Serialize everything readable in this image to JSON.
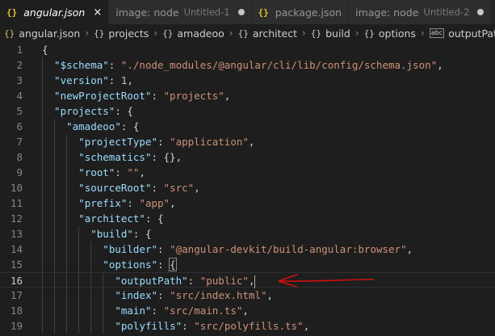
{
  "tabs": [
    {
      "icon": "json-file-icon",
      "glyph": "{}",
      "title": "angular.json",
      "active": true,
      "close": "×"
    },
    {
      "icon": "image-editor-icon",
      "glyph": "≡",
      "title": "image: node",
      "description": "Untitled-1",
      "dirty": true
    },
    {
      "icon": "json-file-icon",
      "glyph": "{}",
      "title": "package.json"
    },
    {
      "icon": "image-editor-icon",
      "glyph": "≡",
      "title": "image: node",
      "description": "Untitled-2",
      "dirty": true
    }
  ],
  "breadcrumb": [
    {
      "icon": "json-file-icon",
      "glyph": "{}",
      "label": "angular.json"
    },
    {
      "icon": "object-icon",
      "glyph": "{}",
      "label": "projects"
    },
    {
      "icon": "object-icon",
      "glyph": "{}",
      "label": "amadeoo"
    },
    {
      "icon": "object-icon",
      "glyph": "{}",
      "label": "architect"
    },
    {
      "icon": "object-icon",
      "glyph": "{}",
      "label": "build"
    },
    {
      "icon": "object-icon",
      "glyph": "{}",
      "label": "options"
    },
    {
      "icon": "string-icon",
      "glyph": "abc",
      "label": "outputPath"
    }
  ],
  "separator": "›",
  "lines": [
    {
      "n": "1",
      "indent": 0,
      "tokens": [
        {
          "t": "{",
          "c": "punct"
        }
      ]
    },
    {
      "n": "2",
      "indent": 1,
      "tokens": [
        {
          "t": "\"$schema\"",
          "c": "key"
        },
        {
          "t": ": ",
          "c": "punct"
        },
        {
          "t": "\"./node_modules/@angular/cli/lib/config/schema.json\"",
          "c": "str"
        },
        {
          "t": ",",
          "c": "punct"
        }
      ]
    },
    {
      "n": "3",
      "indent": 1,
      "tokens": [
        {
          "t": "\"version\"",
          "c": "key"
        },
        {
          "t": ": ",
          "c": "punct"
        },
        {
          "t": "1",
          "c": "num"
        },
        {
          "t": ",",
          "c": "punct"
        }
      ]
    },
    {
      "n": "4",
      "indent": 1,
      "tokens": [
        {
          "t": "\"newProjectRoot\"",
          "c": "key"
        },
        {
          "t": ": ",
          "c": "punct"
        },
        {
          "t": "\"projects\"",
          "c": "str"
        },
        {
          "t": ",",
          "c": "punct"
        }
      ]
    },
    {
      "n": "5",
      "indent": 1,
      "tokens": [
        {
          "t": "\"projects\"",
          "c": "key"
        },
        {
          "t": ": {",
          "c": "punct"
        }
      ]
    },
    {
      "n": "6",
      "indent": 2,
      "tokens": [
        {
          "t": "\"amadeoo\"",
          "c": "key"
        },
        {
          "t": ": {",
          "c": "punct"
        }
      ]
    },
    {
      "n": "7",
      "indent": 3,
      "tokens": [
        {
          "t": "\"projectType\"",
          "c": "key"
        },
        {
          "t": ": ",
          "c": "punct"
        },
        {
          "t": "\"application\"",
          "c": "str"
        },
        {
          "t": ",",
          "c": "punct"
        }
      ]
    },
    {
      "n": "8",
      "indent": 3,
      "tokens": [
        {
          "t": "\"schematics\"",
          "c": "key"
        },
        {
          "t": ": {},",
          "c": "punct"
        }
      ]
    },
    {
      "n": "9",
      "indent": 3,
      "tokens": [
        {
          "t": "\"root\"",
          "c": "key"
        },
        {
          "t": ": ",
          "c": "punct"
        },
        {
          "t": "\"\"",
          "c": "str"
        },
        {
          "t": ",",
          "c": "punct"
        }
      ]
    },
    {
      "n": "10",
      "indent": 3,
      "tokens": [
        {
          "t": "\"sourceRoot\"",
          "c": "key"
        },
        {
          "t": ": ",
          "c": "punct"
        },
        {
          "t": "\"src\"",
          "c": "str"
        },
        {
          "t": ",",
          "c": "punct"
        }
      ]
    },
    {
      "n": "11",
      "indent": 3,
      "tokens": [
        {
          "t": "\"prefix\"",
          "c": "key"
        },
        {
          "t": ": ",
          "c": "punct"
        },
        {
          "t": "\"app\"",
          "c": "str"
        },
        {
          "t": ",",
          "c": "punct"
        }
      ]
    },
    {
      "n": "12",
      "indent": 3,
      "tokens": [
        {
          "t": "\"architect\"",
          "c": "key"
        },
        {
          "t": ": {",
          "c": "punct"
        }
      ]
    },
    {
      "n": "13",
      "indent": 4,
      "tokens": [
        {
          "t": "\"build\"",
          "c": "key"
        },
        {
          "t": ": {",
          "c": "punct"
        }
      ]
    },
    {
      "n": "14",
      "indent": 5,
      "tokens": [
        {
          "t": "\"builder\"",
          "c": "key"
        },
        {
          "t": ": ",
          "c": "punct"
        },
        {
          "t": "\"@angular-devkit/build-angular:browser\"",
          "c": "str"
        },
        {
          "t": ",",
          "c": "punct"
        }
      ]
    },
    {
      "n": "15",
      "indent": 5,
      "tokens": [
        {
          "t": "\"options\"",
          "c": "key"
        },
        {
          "t": ": ",
          "c": "punct"
        },
        {
          "t": "{",
          "c": "punct bracket-match"
        }
      ]
    },
    {
      "n": "16",
      "indent": 6,
      "current": true,
      "tokens": [
        {
          "t": "\"outputPath\"",
          "c": "key"
        },
        {
          "t": ": ",
          "c": "punct"
        },
        {
          "t": "\"public\"",
          "c": "str"
        },
        {
          "t": ",",
          "c": "punct"
        }
      ]
    },
    {
      "n": "17",
      "indent": 6,
      "tokens": [
        {
          "t": "\"index\"",
          "c": "key"
        },
        {
          "t": ": ",
          "c": "punct"
        },
        {
          "t": "\"src/index.html\"",
          "c": "str"
        },
        {
          "t": ",",
          "c": "punct"
        }
      ]
    },
    {
      "n": "18",
      "indent": 6,
      "tokens": [
        {
          "t": "\"main\"",
          "c": "key"
        },
        {
          "t": ": ",
          "c": "punct"
        },
        {
          "t": "\"src/main.ts\"",
          "c": "str"
        },
        {
          "t": ",",
          "c": "punct"
        }
      ]
    },
    {
      "n": "19",
      "indent": 6,
      "tokens": [
        {
          "t": "\"polyfills\"",
          "c": "key"
        },
        {
          "t": ": ",
          "c": "punct"
        },
        {
          "t": "\"src/polyfills.ts\"",
          "c": "str"
        },
        {
          "t": ",",
          "c": "punct"
        }
      ]
    }
  ],
  "annotation": {
    "kind": "hand-drawn-arrow",
    "color": "#d01010",
    "points_to_line": "16"
  },
  "colors": {
    "background": "#1e1e1e",
    "key": "#9cdcfe",
    "string": "#ce9178",
    "number": "#b5cea8",
    "arrow": "#d01010"
  }
}
